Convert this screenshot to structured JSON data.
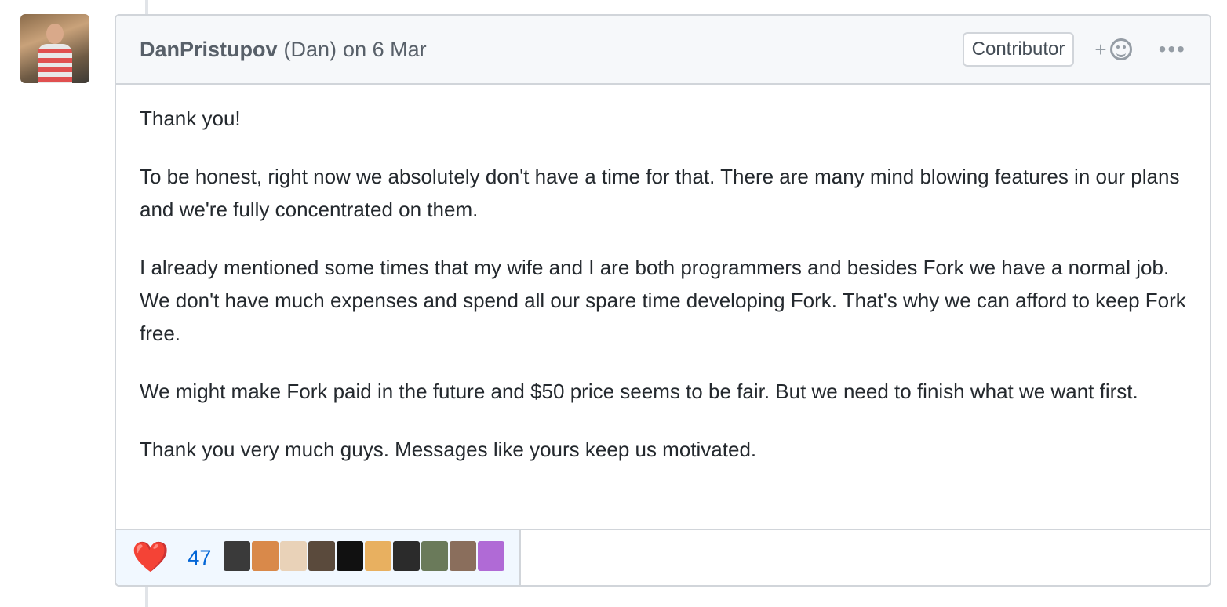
{
  "comment": {
    "author": "DanPristupov",
    "author_fullname": "(Dan)",
    "date": "on 6 Mar",
    "badge": "Contributor",
    "add_reaction": "+",
    "more": "•••",
    "paragraphs": [
      "Thank you!",
      "To be honest, right now we absolutely don't have a time for that. There are many mind blowing features in our plans and we're fully concentrated on them.",
      "I already mentioned some times that my wife and I are both programmers and besides Fork we have a normal job. We don't have much expenses and spend all our spare time developing Fork. That's why we can afford to keep Fork free.",
      "We might make Fork paid in the future and $50 price seems to be fair. But we need to finish what we want first.",
      "Thank you very much guys. Messages like yours keep us motivated."
    ],
    "reactions": {
      "emoji": "❤️",
      "count": "47",
      "reactor_colors": [
        "#3a3a3a",
        "#d9894a",
        "#e9d2b8",
        "#5a4a3c",
        "#111111",
        "#e8b060",
        "#2b2b2b",
        "#6a7a5a",
        "#8a6e5c",
        "#b06ad6"
      ]
    }
  }
}
